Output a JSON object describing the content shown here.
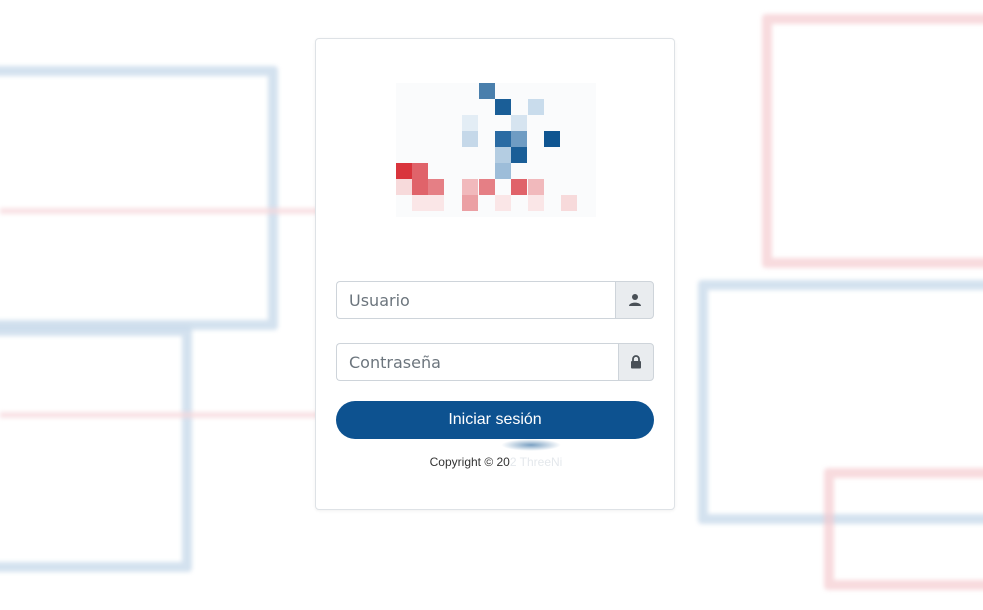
{
  "login": {
    "username": {
      "placeholder": "Usuario",
      "value": "",
      "icon": "user-icon"
    },
    "password": {
      "placeholder": "Contraseña",
      "value": "",
      "icon": "lock-icon"
    },
    "submit_label": "Iniciar sesión",
    "copyright_prefix": "Copyright © 20",
    "copyright_faded": "2 ThreeNi"
  },
  "colors": {
    "primary": "#0d5290",
    "addon_bg": "#e9ecef",
    "border": "#ced4da",
    "logo_blue": "#1a5e97",
    "logo_red": "#d9343c"
  }
}
